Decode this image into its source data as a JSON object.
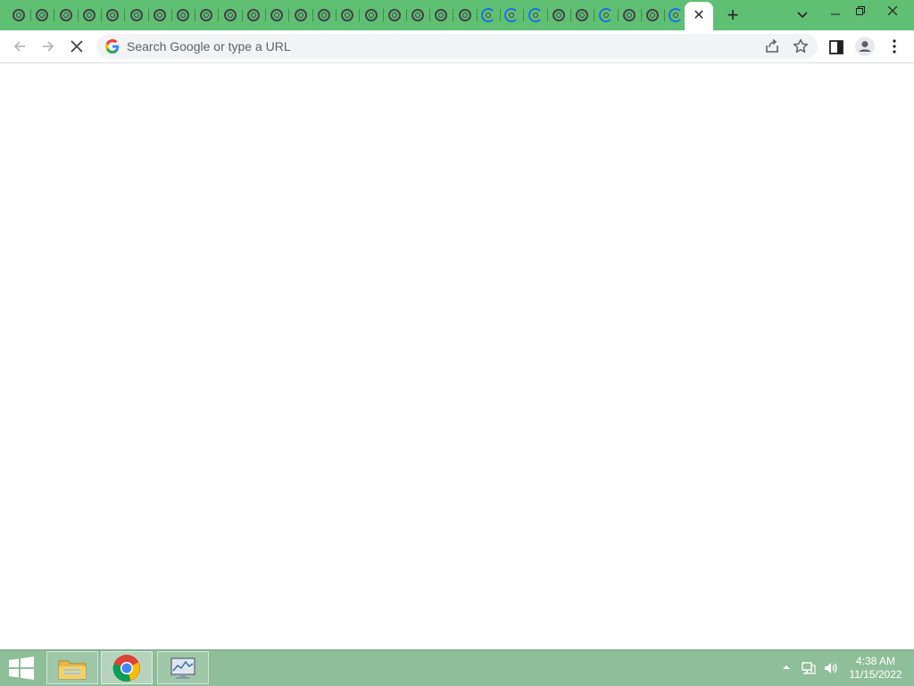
{
  "window": {
    "tab_strip": {
      "pinned_tabs": [
        {
          "icon": "chrome-favicon-icon"
        },
        {
          "icon": "chrome-favicon-icon"
        },
        {
          "icon": "chrome-favicon-icon"
        },
        {
          "icon": "chrome-favicon-icon"
        },
        {
          "icon": "chrome-favicon-icon"
        },
        {
          "icon": "chrome-favicon-icon"
        },
        {
          "icon": "chrome-favicon-icon"
        },
        {
          "icon": "chrome-favicon-icon"
        },
        {
          "icon": "chrome-favicon-icon"
        },
        {
          "icon": "chrome-favicon-icon"
        },
        {
          "icon": "chrome-favicon-icon"
        },
        {
          "icon": "chrome-favicon-icon"
        },
        {
          "icon": "chrome-favicon-icon"
        },
        {
          "icon": "chrome-favicon-icon"
        },
        {
          "icon": "chrome-favicon-icon"
        },
        {
          "icon": "chrome-favicon-icon"
        },
        {
          "icon": "chrome-favicon-icon"
        },
        {
          "icon": "chrome-favicon-icon"
        },
        {
          "icon": "chrome-favicon-icon"
        },
        {
          "icon": "chrome-favicon-icon"
        },
        {
          "icon": "loading-spinner-icon"
        },
        {
          "icon": "loading-spinner-icon"
        },
        {
          "icon": "loading-spinner-icon"
        },
        {
          "icon": "chrome-favicon-icon"
        },
        {
          "icon": "chrome-favicon-icon"
        },
        {
          "icon": "loading-spinner-icon"
        },
        {
          "icon": "chrome-favicon-icon"
        },
        {
          "icon": "chrome-favicon-icon"
        },
        {
          "icon": "loading-spinner-icon"
        }
      ],
      "active_tab": {
        "close_icon": "close-icon"
      },
      "new_tab_icon": "plus-icon",
      "tab_search_icon": "chevron-down-icon"
    },
    "controls": {
      "minimize_icon": "minimize-icon",
      "restore_icon": "restore-icon",
      "close_icon": "close-icon"
    }
  },
  "toolbar": {
    "omnibox": {
      "placeholder": "Search Google or type a URL",
      "value": ""
    },
    "icons": [
      "back-arrow-icon",
      "forward-arrow-icon",
      "stop-icon",
      "google-icon",
      "share-icon",
      "star-icon",
      "side-panel-icon",
      "profile-icon",
      "menu-icon"
    ]
  },
  "taskbar": {
    "apps": [
      {
        "name": "File Explorer",
        "icon": "folder-icon"
      },
      {
        "name": "Google Chrome",
        "icon": "chrome-icon"
      },
      {
        "name": "Resource Monitor",
        "icon": "monitor-icon"
      }
    ],
    "clock": {
      "time": "4:38 AM",
      "date": "11/15/2022"
    }
  },
  "colors": {
    "tab_strip_bg": "#5fbf72",
    "taskbar_bg": "#8fbe9a",
    "omnibox_bg": "#f1f3f4",
    "accent_blue": "#1a73e8"
  }
}
